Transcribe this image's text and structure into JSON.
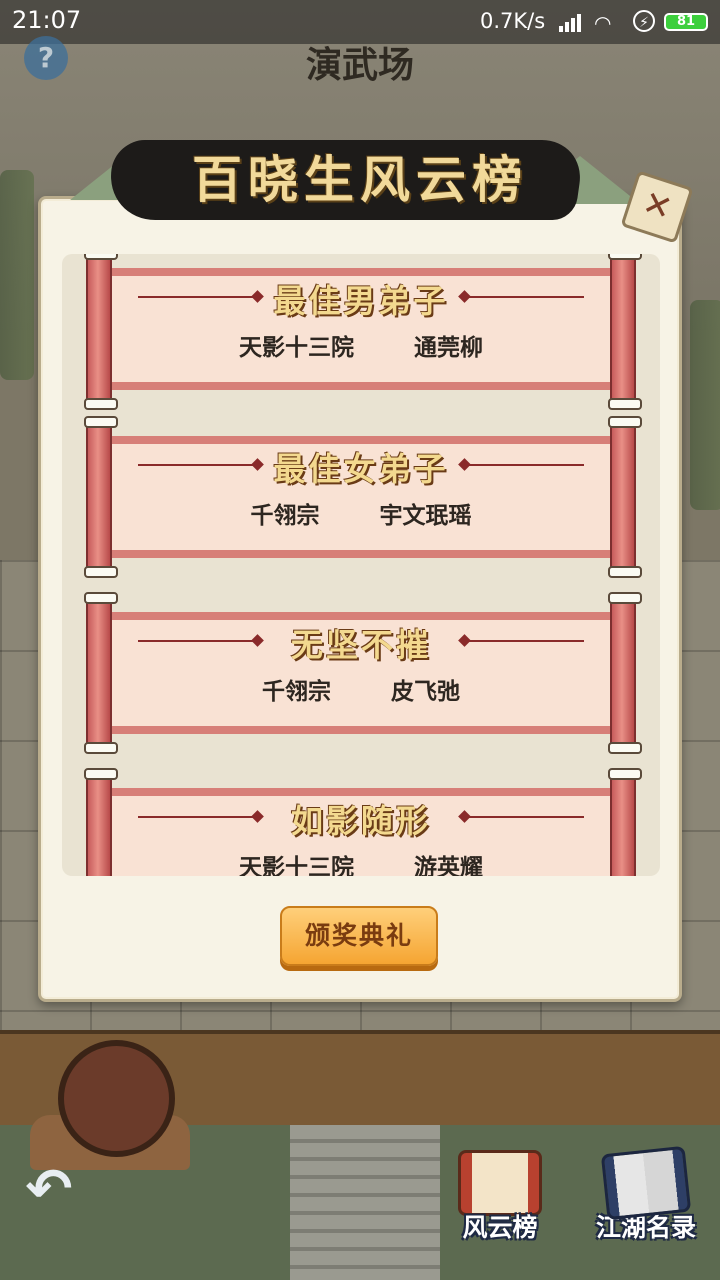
{
  "status_bar": {
    "time": "21:07",
    "network_speed": "0.7K/s",
    "battery": "81"
  },
  "scene": {
    "title": "演武场"
  },
  "dialog": {
    "title": "百晓生风云榜",
    "awards": [
      {
        "title": "最佳男弟子",
        "sect": "天影十三院",
        "name": "通莞柳"
      },
      {
        "title": "最佳女弟子",
        "sect": "千翎宗",
        "name": "宇文珉瑶"
      },
      {
        "title": "无坚不摧",
        "sect": "千翎宗",
        "name": "皮飞弛"
      },
      {
        "title": "如影随形",
        "sect": "天影十三院",
        "name": "游英耀"
      }
    ],
    "ceremony_button": "颁奖典礼"
  },
  "bottom_nav": {
    "items": [
      {
        "label": "风云榜",
        "icon": "scroll-icon"
      },
      {
        "label": "江湖名录",
        "icon": "book-icon"
      }
    ]
  },
  "colors": {
    "accent": "#f5a532",
    "scroll_red": "#d77f78",
    "dialog_bg": "#f7f3e6"
  }
}
